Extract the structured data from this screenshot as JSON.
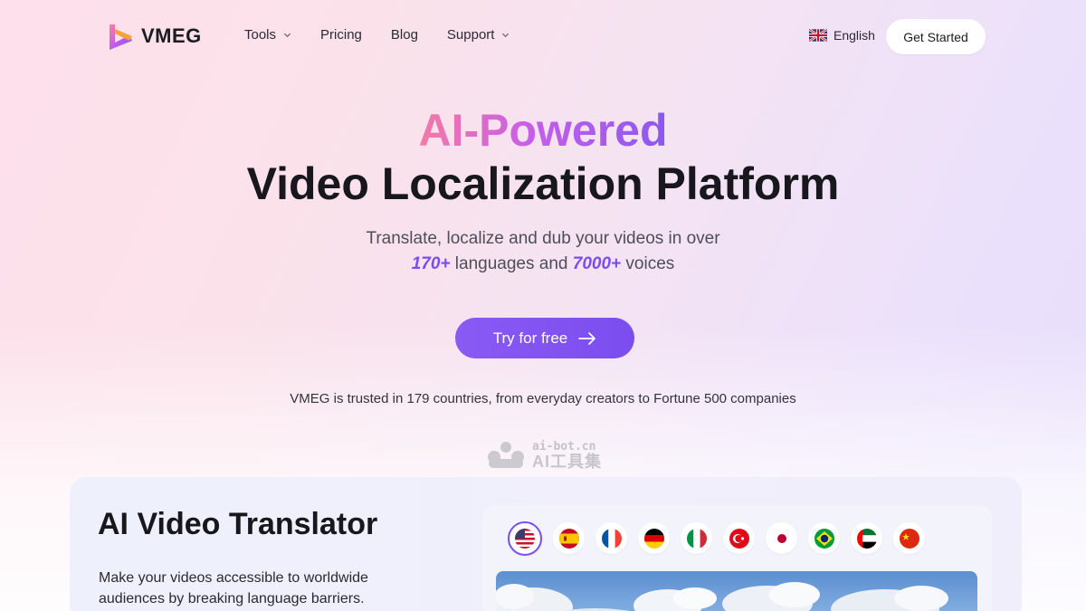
{
  "nav": {
    "logo_text": "VMEG",
    "links": [
      {
        "label": "Tools",
        "has_dropdown": true
      },
      {
        "label": "Pricing",
        "has_dropdown": false
      },
      {
        "label": "Blog",
        "has_dropdown": false
      },
      {
        "label": "Support",
        "has_dropdown": true
      }
    ],
    "language": {
      "label": "English",
      "icon": "uk-flag-icon"
    },
    "cta_label": "Get Started"
  },
  "hero": {
    "kicker": "AI-Powered",
    "title": "Video Localization Platform",
    "subtitle_line1": "Translate, localize and dub your videos in over",
    "languages_count": "170+",
    "middle_text": "languages and",
    "voices_count": "7000+",
    "end_text": "voices",
    "cta_label": "Try for free",
    "trusted_text": "VMEG is trusted in 179 countries, from everyday creators to Fortune 500 companies"
  },
  "watermark": {
    "url": "ai-bot.cn",
    "name": "AI工具集"
  },
  "feature": {
    "title": "AI Video Translator",
    "description": "Make your videos accessible to worldwide audiences by breaking language barriers.",
    "flags": [
      "us",
      "es",
      "fr",
      "de",
      "it",
      "tr",
      "jp",
      "br",
      "ae",
      "cn"
    ],
    "selected_flag": "us"
  },
  "colors": {
    "accent": "#7b4dee",
    "gradient_start": "#f47aa6",
    "gradient_end": "#8a58f2"
  }
}
